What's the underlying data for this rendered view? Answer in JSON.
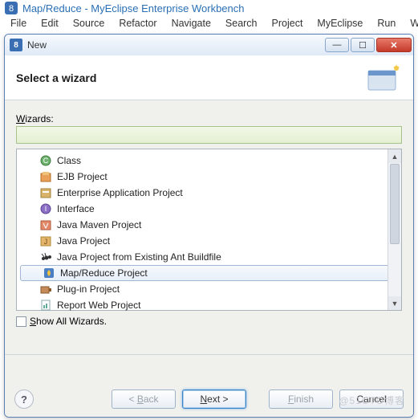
{
  "ide": {
    "title": "Map/Reduce - MyEclipse Enterprise Workbench",
    "menus": [
      "File",
      "Edit",
      "Source",
      "Refactor",
      "Navigate",
      "Search",
      "Project",
      "MyEclipse",
      "Run",
      "Window"
    ]
  },
  "dialog": {
    "title": "New",
    "banner_title": "Select a wizard",
    "wizards_label": "Wizards:",
    "show_all_label": "Show All Wizards.",
    "filter_value": "",
    "items": [
      {
        "label": "Class",
        "icon": "class-icon"
      },
      {
        "label": "EJB Project",
        "icon": "ejb-icon"
      },
      {
        "label": "Enterprise Application Project",
        "icon": "ear-icon"
      },
      {
        "label": "Interface",
        "icon": "interface-icon"
      },
      {
        "label": "Java Maven Project",
        "icon": "maven-icon"
      },
      {
        "label": "Java Project",
        "icon": "java-icon"
      },
      {
        "label": "Java Project from Existing Ant Buildfile",
        "icon": "ant-icon"
      },
      {
        "label": "Map/Reduce Project",
        "icon": "mapreduce-icon",
        "selected": true
      },
      {
        "label": "Plug-in Project",
        "icon": "plugin-icon"
      },
      {
        "label": "Report Web Project",
        "icon": "report-icon"
      }
    ],
    "buttons": {
      "back": "< Back",
      "next": "Next >",
      "finish": "Finish",
      "cancel": "Cancel"
    }
  },
  "watermark": "@51CTO博客"
}
